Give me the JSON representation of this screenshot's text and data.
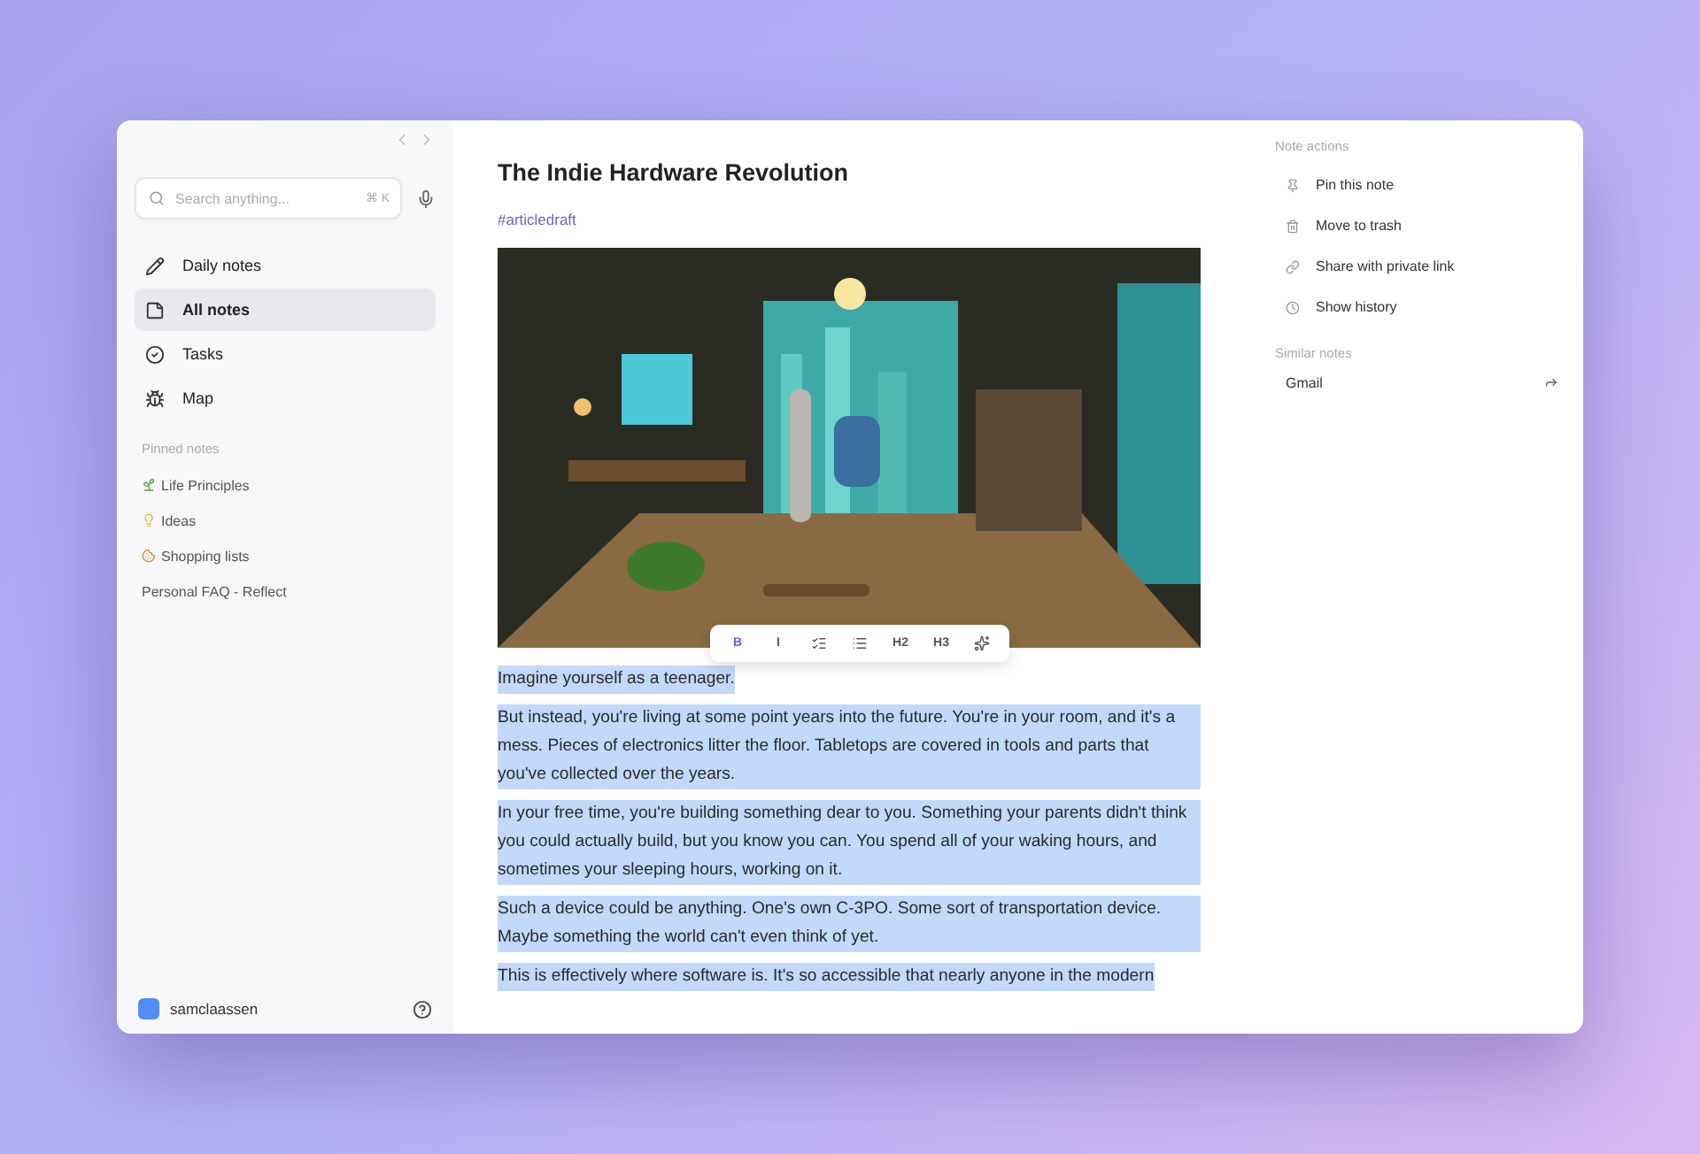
{
  "sidebar": {
    "search": {
      "placeholder": "Search anything...",
      "shortcut": "⌘ K"
    },
    "nav": [
      {
        "label": "Daily notes",
        "selected": false
      },
      {
        "label": "All notes",
        "selected": true
      },
      {
        "label": "Tasks",
        "selected": false
      },
      {
        "label": "Map",
        "selected": false
      }
    ],
    "pinned_title": "Pinned notes",
    "pinned": [
      {
        "label": "Life Principles"
      },
      {
        "label": "Ideas"
      },
      {
        "label": "Shopping lists"
      },
      {
        "label": "Personal FAQ - Reflect"
      }
    ],
    "user": {
      "name": "samclaassen",
      "color": "#4f8ef7"
    }
  },
  "note": {
    "title": "The Indie Hardware Revolution",
    "tag": "#articledraft",
    "toolbar": [
      {
        "label": "B",
        "kind": "bold",
        "selected": true
      },
      {
        "label": "I",
        "kind": "italic",
        "selected": false
      },
      {
        "kind": "checklist",
        "selected": false
      },
      {
        "kind": "bullets",
        "selected": false
      },
      {
        "label": "H2",
        "kind": "heading",
        "selected": false
      },
      {
        "label": "H3",
        "kind": "heading",
        "selected": false
      },
      {
        "kind": "sparkle",
        "selected": false
      }
    ],
    "paragraphs": [
      {
        "text": "Imagine yourself as a teenager.",
        "selected": true
      },
      {
        "text": "But instead, you're living at some point years into the future. You're in your room, and it's a mess. Pieces of electronics litter the floor. Tabletops are covered in tools and parts that you've collected over the years.",
        "selected": true
      },
      {
        "text": "In your free time, you're building something dear to you. Something your parents didn't think you could actually build, but you know you can. You spend all of your waking hours, and sometimes your sleeping hours, working on it.",
        "selected": true
      },
      {
        "text": "Such a device could be anything. One's own C-3PO. Some sort of transportation device. Maybe something the world can't even think of yet.",
        "selected": true
      },
      {
        "text": "This is effectively where software is. It's so accessible that nearly anyone in the modern",
        "selected": true
      }
    ]
  },
  "actions": {
    "title": "Note actions",
    "items": [
      {
        "label": "Pin this note"
      },
      {
        "label": "Move to trash"
      },
      {
        "label": "Share with private link"
      },
      {
        "label": "Show history"
      }
    ],
    "similar_title": "Similar notes",
    "similar": [
      {
        "label": "Gmail"
      }
    ]
  }
}
